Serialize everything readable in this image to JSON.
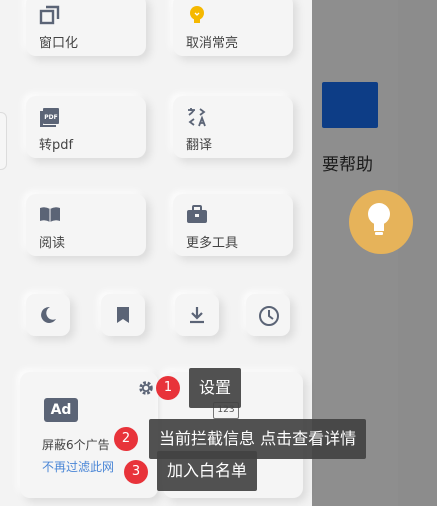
{
  "tiles": [
    {
      "label": "窗口化",
      "icon": "window-icon"
    },
    {
      "label": "取消常亮",
      "icon": "bulb-icon"
    },
    {
      "label": "转pdf",
      "icon": "pdf-icon"
    },
    {
      "label": "翻译",
      "icon": "translate-icon"
    },
    {
      "label": "阅读",
      "icon": "book-icon"
    },
    {
      "label": "更多工具",
      "icon": "toolbox-icon"
    }
  ],
  "small_buttons": [
    "moon-icon",
    "bookmark-icon",
    "download-icon",
    "history-icon"
  ],
  "ad_card": {
    "badge": "Ad",
    "blocked_text": "屏蔽6个广告",
    "link_text": "不再过滤此网"
  },
  "card2": {
    "badge": "123"
  },
  "background": {
    "help_text": "要帮助"
  },
  "tooltips": [
    {
      "num": "1",
      "text": "设置"
    },
    {
      "num": "2",
      "text": "当前拦截信息 点击查看详情"
    },
    {
      "num": "3",
      "text": "加入白名单"
    }
  ],
  "colors": {
    "accent_red": "#e8333a",
    "link_blue": "#4a86d6",
    "bulb_yellow": "#f5b800"
  }
}
